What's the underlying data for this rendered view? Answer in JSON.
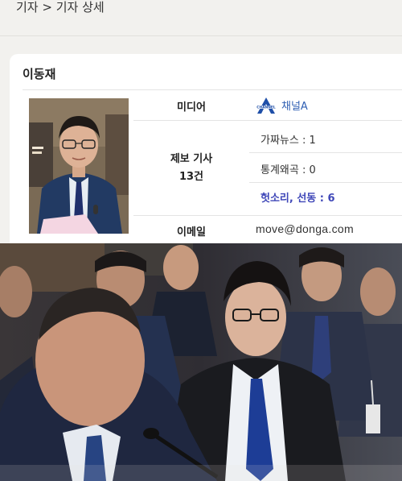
{
  "breadcrumb": {
    "text": "기자 > 기자 상세"
  },
  "reporter": {
    "name": "이동재"
  },
  "fields": {
    "media": {
      "label": "미디어",
      "logo_text": "CHANNEL",
      "value": "채널A"
    },
    "tips": {
      "label_line1": "제보 기사",
      "label_line2": "13건",
      "items": [
        {
          "text": "가짜뉴스 : 1"
        },
        {
          "text": "통계왜곡 : 0"
        },
        {
          "text": "헛소리, 선동 : 6"
        }
      ]
    },
    "email": {
      "label": "이메일",
      "value": "move@donga.com"
    }
  },
  "colors": {
    "accent": "#3f47b8",
    "link": "#2f5fb3",
    "background": "#f2f1ee",
    "card": "#ffffff"
  }
}
